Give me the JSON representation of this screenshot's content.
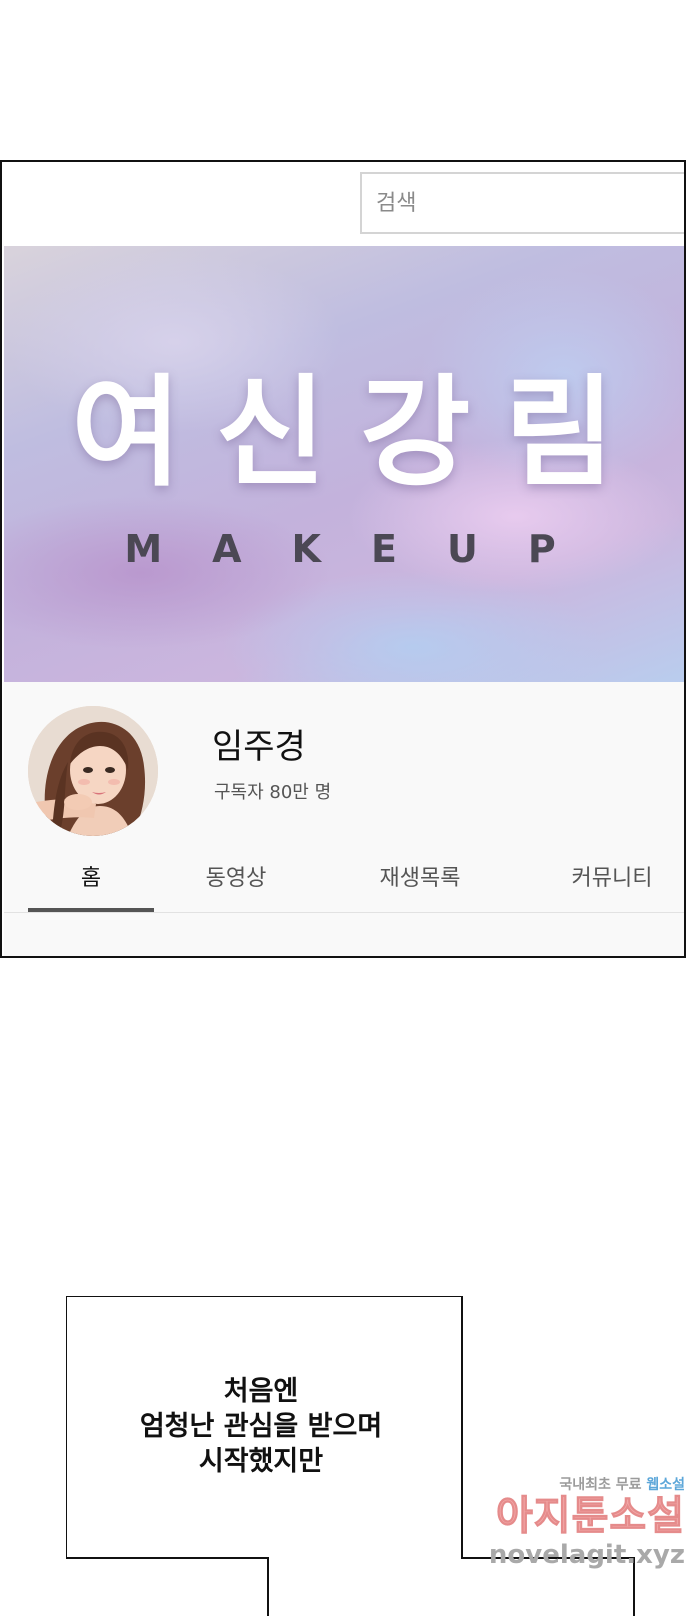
{
  "search": {
    "placeholder": "검색"
  },
  "banner": {
    "title": "여신강림",
    "subtitle": "MAKEUP"
  },
  "channel": {
    "name": "임주경",
    "subscribers": "구독자 80만 명"
  },
  "tabs": [
    {
      "label": "홈",
      "active": true
    },
    {
      "label": "동영상",
      "active": false
    },
    {
      "label": "재생목록",
      "active": false
    },
    {
      "label": "커뮤니티",
      "active": false
    }
  ],
  "speech": {
    "lines": [
      "처음엔",
      "엄청난 관심을 받으며",
      "시작했지만"
    ]
  },
  "watermark": {
    "tagline_prefix": "국내최초 무료",
    "tagline_accent": "웹소설",
    "brand": "아지툰소설",
    "url": "novelagit.xyz"
  },
  "colors": {
    "tab_indicator": "#555555",
    "watermark_brand": "#f2a7a7",
    "watermark_accent": "#5da7d9"
  }
}
